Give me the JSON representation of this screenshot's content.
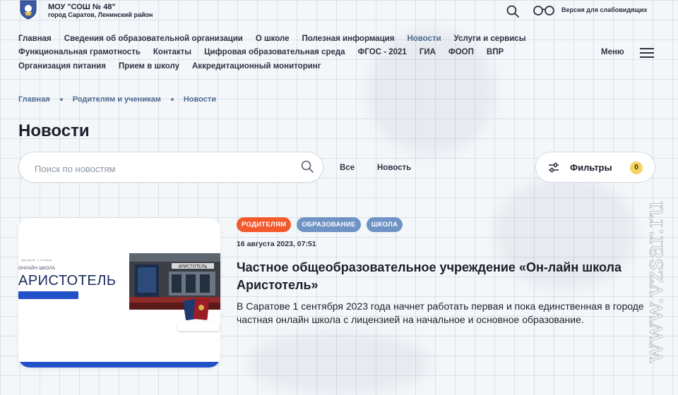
{
  "header": {
    "title": "МОУ \"СОШ № 48\"",
    "subtitle": "город Саратов, Ленинский район",
    "vision_label": "Версия для слабовидящих",
    "search_icon": "search-icon",
    "glasses_icon": "glasses-icon"
  },
  "nav": {
    "row1": [
      "Главная",
      "Сведения об образовательной организации",
      "О школе",
      "Полезная информация",
      "Новости",
      "Услуги и сервисы"
    ],
    "row2": [
      "Функциональная грамотность",
      "Контакты",
      "Цифровая образовательная среда",
      "ФГОС - 2021",
      "ГИА",
      "ФООП",
      "ВПР"
    ],
    "row3": [
      "Организация питания",
      "Прием в школу",
      "Аккредитационный мониторинг"
    ],
    "active": "Новости",
    "menu_label": "Меню"
  },
  "breadcrumb": [
    "Главная",
    "Родителям и ученикам",
    "Новости"
  ],
  "page_title": "Новости",
  "search": {
    "placeholder": "Поиск по новостям",
    "value": ""
  },
  "segments": [
    "Все",
    "Новость"
  ],
  "filters": {
    "label": "Фильтры",
    "count": "0"
  },
  "news": [
    {
      "tags": [
        {
          "label": "РОДИТЕЛЯМ",
          "color": "#f2592b"
        },
        {
          "label": "ОБРАЗОВАНИЕ",
          "color": "#6e93c4"
        },
        {
          "label": "ШКОЛА",
          "color": "#6e93c4"
        }
      ],
      "date": "16 августа 2023, 07:51",
      "title": "Частное общеобразовательное учреждение «Он-лайн школа Аристотель»",
      "excerpt": "В Саратове 1 сентября 2023 года начнет работать первая и пока единственная в городе частная онлайн школа с лицензией на начальное и основное образование.",
      "image": {
        "small_text": "ОНЛАЙН ШКОЛА",
        "brand": "АРИСТОТЕЛЬ",
        "tag": "Для детей · 1–9 классы",
        "sign": "АРИСТОТЕЛЬ"
      }
    }
  ],
  "watermark": "www.vzsar.ru",
  "colors": {
    "accent": "#4e6b8f",
    "orange": "#f2592b",
    "tag_blue": "#6e93c4",
    "brand_blue": "#2250c8",
    "badge_yellow": "#f4d35e"
  }
}
